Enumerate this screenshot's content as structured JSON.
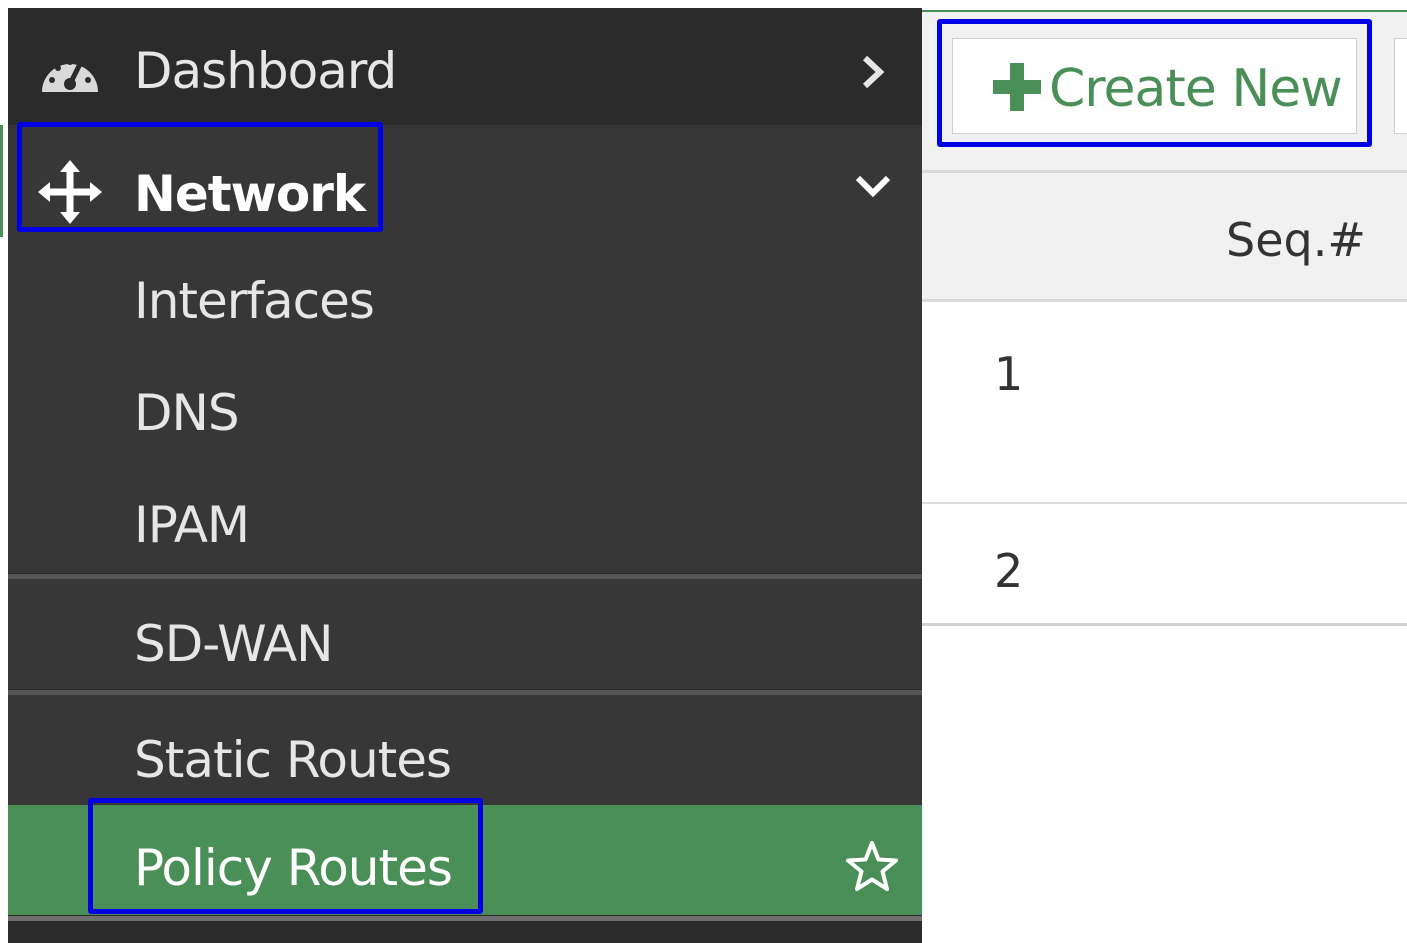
{
  "sidebar": {
    "items": [
      {
        "label": "Dashboard",
        "icon": "dashboard-icon",
        "expand": "chevron-right-icon"
      },
      {
        "label": "Network",
        "icon": "move-arrows-icon",
        "expand": "chevron-down-icon",
        "active": true
      },
      {
        "label": "Interfaces"
      },
      {
        "label": "DNS"
      },
      {
        "label": "IPAM"
      },
      {
        "label": "SD-WAN"
      },
      {
        "label": "Static Routes"
      },
      {
        "label": "Policy Routes",
        "selected": true,
        "icon": "star-icon"
      }
    ]
  },
  "toolbar": {
    "create_label": "Create New",
    "create_icon": "plus-icon"
  },
  "table": {
    "columns": [
      "Seq.#"
    ],
    "rows": [
      {
        "seq": "1"
      },
      {
        "seq": "2"
      }
    ]
  },
  "colors": {
    "sidebar_bg": "#373737",
    "sidebar_header_bg": "#2b2b2b",
    "selected_bg": "#4a8f58",
    "accent_green": "#4a8f58",
    "highlight_box": "#0000e6"
  }
}
